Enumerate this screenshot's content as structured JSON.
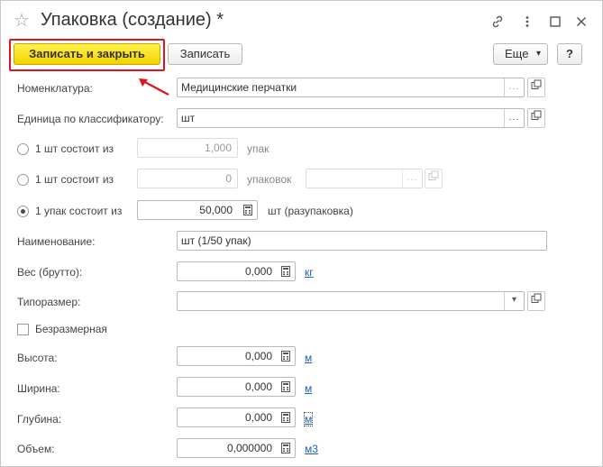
{
  "window": {
    "title": "Упаковка (создание) *"
  },
  "toolbar": {
    "save_close_label": "Записать и закрыть",
    "save_label": "Записать",
    "more_label": "Еще",
    "help_label": "?"
  },
  "form": {
    "nomenclature": {
      "label": "Номенклатура:",
      "value": "Медицинские перчатки"
    },
    "unit_classifier": {
      "label": "Единица по классификатору:",
      "value": "шт"
    },
    "option1": {
      "label": "1 шт состоит из",
      "value": "1,000",
      "unit": "упак",
      "selected": false
    },
    "option2": {
      "label": "1 шт состоит из",
      "value": "0",
      "unit": "упаковок",
      "selected": false
    },
    "option3": {
      "label": "1 упак состоит из",
      "value": "50,000",
      "unit": "шт (разупаковка)",
      "selected": true
    },
    "name": {
      "label": "Наименование:",
      "value": "шт (1/50 упак)"
    },
    "weight": {
      "label": "Вес (брутто):",
      "value": "0,000",
      "unit": "кг"
    },
    "size_type": {
      "label": "Типоразмер:",
      "value": ""
    },
    "sizeless": {
      "label": "Безразмерная",
      "checked": false
    },
    "height": {
      "label": "Высота:",
      "value": "0,000",
      "unit": "м"
    },
    "width": {
      "label": "Ширина:",
      "value": "0,000",
      "unit": "м"
    },
    "depth": {
      "label": "Глубина:",
      "value": "0,000",
      "unit": "м"
    },
    "volume": {
      "label": "Объем:",
      "value": "0,000000",
      "unit": "м3"
    }
  },
  "icons": {
    "star": "☆",
    "link": "⚯",
    "menu": "⋮",
    "maximize": "□",
    "close": "×",
    "open": "⧉",
    "select": "...",
    "calc": "▦",
    "dropdown": "▾"
  },
  "colors": {
    "primary_button": "#f5d900",
    "highlight_frame": "#e0141e",
    "link": "#1f5fb5"
  }
}
